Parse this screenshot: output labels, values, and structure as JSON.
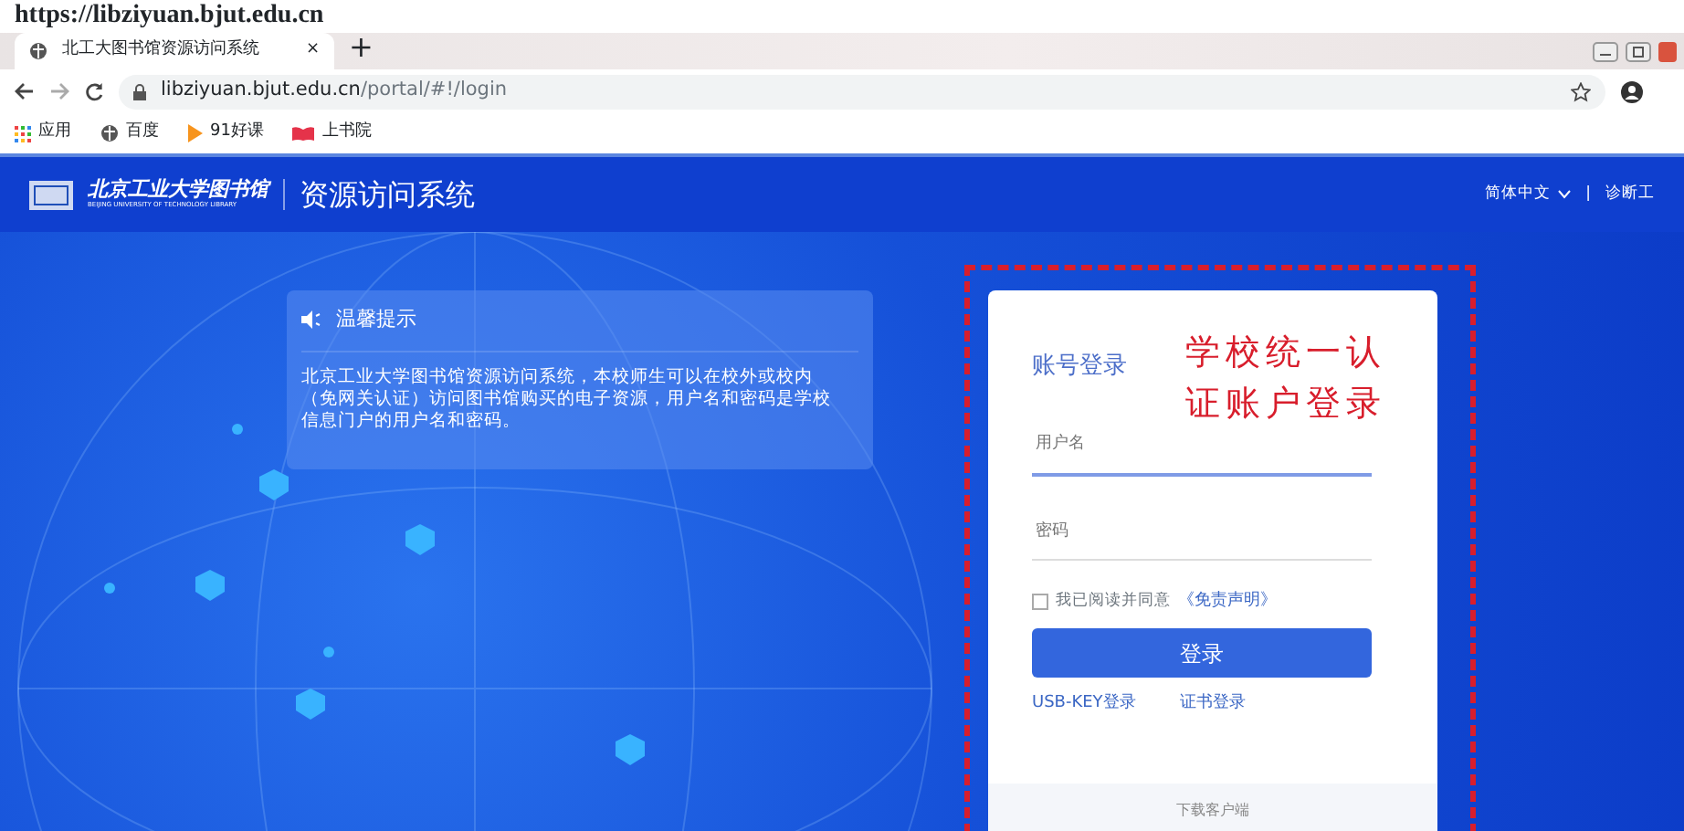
{
  "heading": "https://libziyuan.bjut.edu.cn",
  "browser": {
    "tab": {
      "title": "北工大图书馆资源访问系统",
      "close": "×",
      "new": "+"
    },
    "url": {
      "host": "libziyuan.bjut.edu.cn",
      "path": "/portal/#!/login"
    },
    "bookmarks": [
      {
        "label": "应用",
        "kind": "apps"
      },
      {
        "label": "百度",
        "kind": "globe"
      },
      {
        "label": "91好课",
        "kind": "play"
      },
      {
        "label": "上书院",
        "kind": "book"
      }
    ]
  },
  "header": {
    "logo": "北京工业大学图书馆",
    "logo_sub": "BEIJING UNIVERSITY OF TECHNOLOGY LIBRARY",
    "title": "资源访问系统",
    "language": "简体中文",
    "separator": "|",
    "tools": "诊断工"
  },
  "notice": {
    "title": "温馨提示",
    "text": "北京工业大学图书馆资源访问系统，本校师生可以在校外或校内（免网关认证）访问图书馆购买的电子资源，用户名和密码是学校信息门户的用户名和密码。"
  },
  "login": {
    "title": "账号登录",
    "annotation": [
      "学校统一认",
      "证账户登录"
    ],
    "username": {
      "placeholder": "用户名"
    },
    "password": {
      "placeholder": "密码"
    },
    "agree": {
      "label": "我已阅读并同意",
      "link": "《免责声明》",
      "checked": false
    },
    "submit": "登录",
    "links": [
      "USB-KEY登录",
      "证书登录"
    ],
    "footer": "下载客户端"
  }
}
